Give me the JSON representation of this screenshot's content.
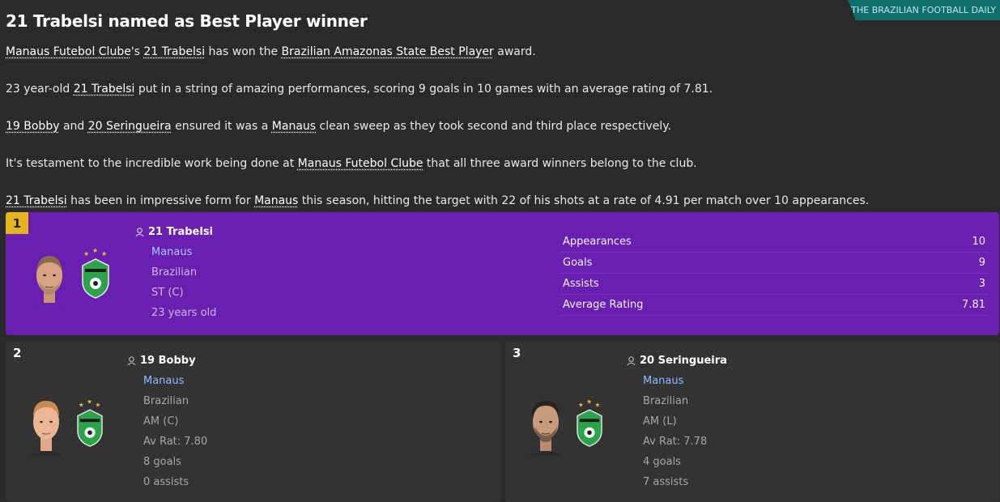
{
  "masthead": "THE BRAZILIAN FOOTBALL DAILY",
  "headline": "21 Trabelsi named as Best Player winner",
  "paragraphs": {
    "p1": {
      "club": "Manaus Futebol Clube",
      "t1": "'s ",
      "player": "21 Trabelsi",
      "t2": " has won the ",
      "award": "Brazilian Amazonas State Best Player",
      "t3": " award."
    },
    "p2": {
      "t1": "23 year-old ",
      "player": "21 Trabelsi",
      "t2": " put in a string of amazing performances, scoring 9 goals in 10 games with an average rating of 7.81."
    },
    "p3": {
      "player2": "19 Bobby",
      "t1": " and ",
      "player3": "20 Seringueira",
      "t2": " ensured it was a ",
      "club": "Manaus",
      "t3": " clean sweep as they took second and third place respectively."
    },
    "p4": {
      "t1": "It's testament to the incredible work being done at ",
      "club": "Manaus Futebol Clube",
      "t2": " that all three award winners belong to the club."
    },
    "p5": {
      "player": "21 Trabelsi",
      "t1": " has been in impressive form for ",
      "club": "Manaus",
      "t2": " this season, hitting the target with 22 of his shots at a rate of 4.91 per match over 10 appearances."
    }
  },
  "winner": {
    "rank": "1",
    "name": "21 Trabelsi",
    "club": "Manaus",
    "nationality": "Brazilian",
    "position": "ST (C)",
    "age": "23 years old",
    "stats": [
      {
        "label": "Appearances",
        "value": "10"
      },
      {
        "label": "Goals",
        "value": "9"
      },
      {
        "label": "Assists",
        "value": "3"
      },
      {
        "label": "Average Rating",
        "value": "7.81"
      }
    ]
  },
  "second": {
    "rank": "2",
    "name": "19 Bobby",
    "club": "Manaus",
    "nationality": "Brazilian",
    "position": "AM (C)",
    "rating": "Av Rat: 7.80",
    "goals": "8 goals",
    "assists": "0 assists"
  },
  "third": {
    "rank": "3",
    "name": "20 Seringueira",
    "club": "Manaus",
    "nationality": "Brazilian",
    "position": "AM (L)",
    "rating": "Av Rat: 7.78",
    "goals": "4 goals",
    "assists": "7 assists"
  },
  "colors": {
    "winner_card": "#6a1fb0",
    "rank_badge": "#e3b51b",
    "masthead": "#0e6f6e",
    "crest_green": "#2aa34a"
  }
}
